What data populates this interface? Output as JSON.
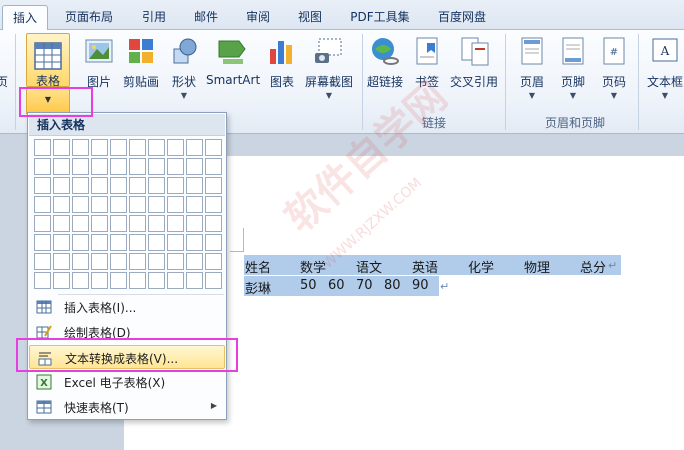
{
  "tabs": [
    "插入",
    "页面布局",
    "引用",
    "邮件",
    "审阅",
    "视图",
    "PDF工具集",
    "百度网盘"
  ],
  "ribbon": {
    "left_partial_label": "页",
    "table_button": "表格",
    "picture_button": "图片",
    "clipart_button": "剪贴画",
    "shapes_button": "形状",
    "smartart_button": "SmartArt",
    "chart_button": "图表",
    "screenshot_button": "屏幕截图",
    "hyperlink_button": "超链接",
    "bookmark_button": "书签",
    "crossref_button": "交叉引用",
    "header_button": "页眉",
    "footer_button": "页脚",
    "pagenum_button": "页码",
    "textbox_button": "文本框",
    "group_links": "链接",
    "group_header_footer": "页眉和页脚"
  },
  "dropdown": {
    "header": "插入表格",
    "grid_rows": 8,
    "grid_cols": 10,
    "items": [
      {
        "label": "插入表格(I)...",
        "icon": "insert-table-icon"
      },
      {
        "label": "绘制表格(D)",
        "icon": "draw-table-icon"
      },
      {
        "label": "文本转换成表格(V)...",
        "icon": "text-to-table-icon"
      },
      {
        "label": "Excel 电子表格(X)",
        "icon": "excel-icon"
      },
      {
        "label": "快速表格(T)",
        "icon": "quick-table-icon"
      }
    ]
  },
  "document": {
    "row1": [
      "姓名",
      "数学",
      "语文",
      "英语",
      "化学",
      "物理",
      "总分"
    ],
    "row2": [
      "彭琳",
      "50",
      "60",
      "70",
      "80",
      "90"
    ],
    "para_mark": "↵"
  },
  "watermark": {
    "main": "软件自学网",
    "url": "WWW.RJZXW.COM"
  },
  "colors": {
    "selection": "#b0ccea",
    "highlight": "#e83ee0",
    "menu_hover": "#ffe594"
  }
}
